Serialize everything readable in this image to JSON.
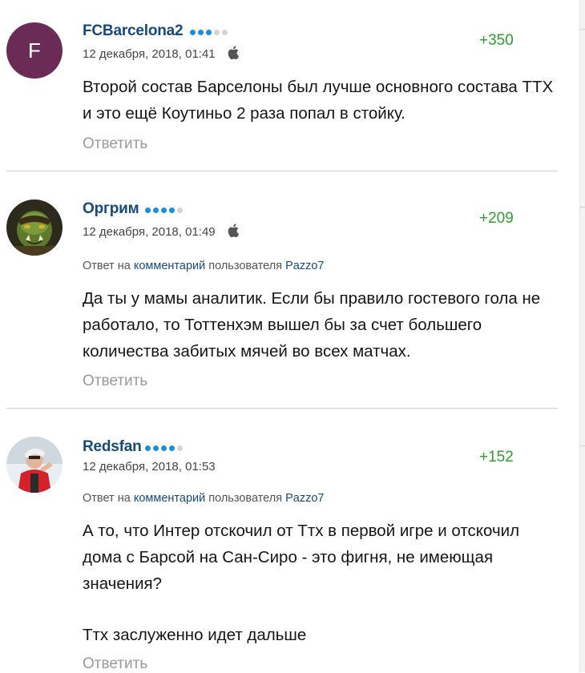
{
  "comments": [
    {
      "username": "FCBarcelona2",
      "avatar_letter": "F",
      "avatar_color": "#6a2b57",
      "rating_dots": 3,
      "date": "12 декабря, 2018, 01:41",
      "device_icon": "apple-icon",
      "votes": "+350",
      "text": "Второй состав Барселоны был лучше основного состава ТТХ и это ещё Коутиньо 2 раза попал в стойку.",
      "reply_label": "Ответить"
    },
    {
      "username": "Оргрим",
      "rating_dots": 4,
      "date": "12 декабря, 2018, 01:49",
      "device_icon": "apple-icon",
      "votes": "+209",
      "reply_to": {
        "prefix": "Ответ на",
        "link": "комментарий",
        "middle": "пользователя",
        "user": "Pazzo7"
      },
      "text": "Да ты у мамы аналитик. Если бы правило гостевого гола не работало, то Тоттенхэм вышел бы за счет большего количества забитых мячей во всех матчах.",
      "reply_label": "Ответить"
    },
    {
      "username": "Redsfan",
      "rating_dots": 4,
      "date": "12 декабря, 2018, 01:53",
      "votes": "+152",
      "reply_to": {
        "prefix": "Ответ на",
        "link": "комментарий",
        "middle": "пользователя",
        "user": "Pazzo7"
      },
      "text_para1": "А то, что Интер отскочил от Ттх в первой игре и отскочил дома с Барсой на Сан-Сиро - это фигня, не имеющая значения?",
      "text_para2": "Ттх заслуженно идет дальше",
      "reply_label": "Ответить"
    }
  ],
  "colors": {
    "username": "#174a7c",
    "votes_positive": "#2f9e2f",
    "rating_on": "#1a8ed8",
    "rating_off": "#d5d5d5"
  }
}
